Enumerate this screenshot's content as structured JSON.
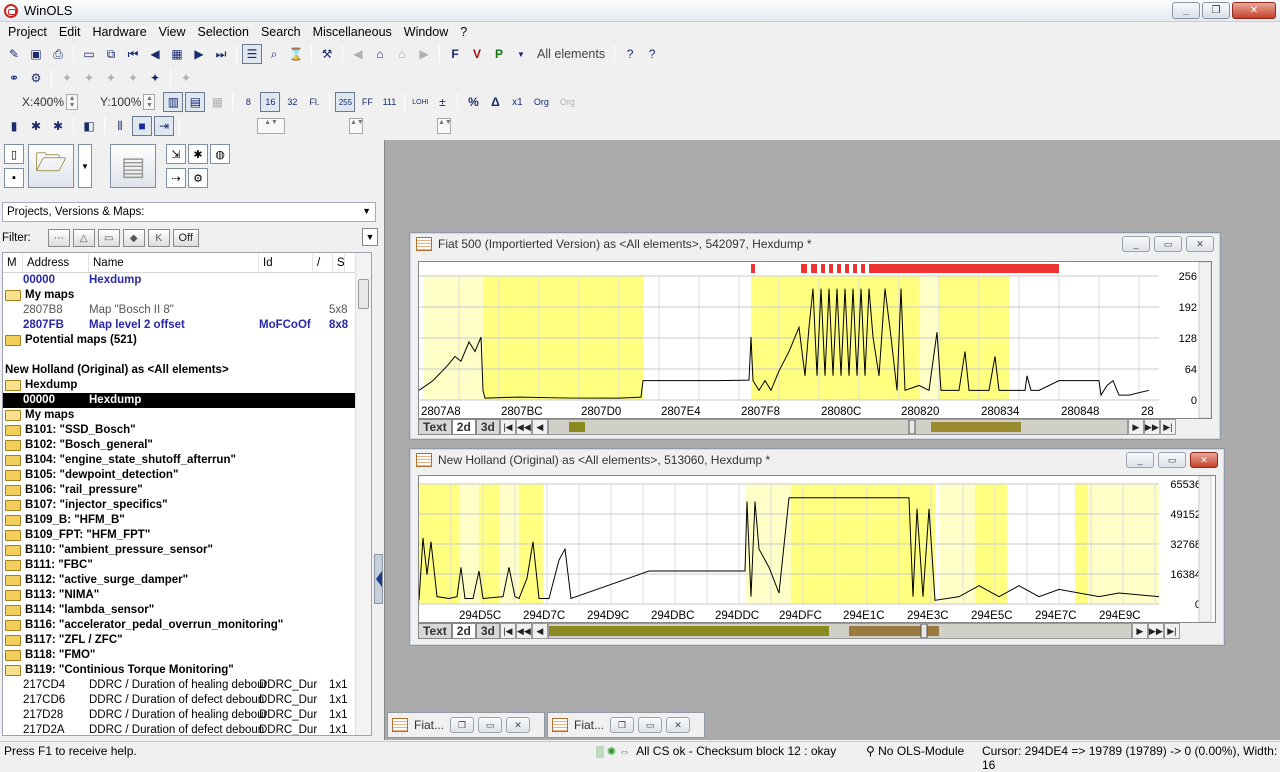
{
  "app": {
    "title": "WinOLS"
  },
  "menu": [
    "Project",
    "Edit",
    "Hardware",
    "View",
    "Selection",
    "Search",
    "Miscellaneous",
    "Window",
    "?"
  ],
  "toolbar1": {
    "elements_label": "All elements"
  },
  "toolbar2": {
    "zoom_x": "X:400%",
    "zoom_y": "Y:100%",
    "btn_8": "8",
    "btn_16": "16",
    "btn_32": "32",
    "btn_fl": "Fl.",
    "btn_255": "255",
    "btn_ff": "FF",
    "btn_111": "111",
    "btn_lohi": "LOHI",
    "btn_percent": "%",
    "btn_delta": "Δ",
    "btn_x1": "x1",
    "btn_org": "Org",
    "btn_org2": "Org"
  },
  "left": {
    "dropdown": "Projects, Versions & Maps:",
    "filter_label": "Filter:",
    "filter_off": "Off",
    "columns": {
      "m": "M",
      "address": "Address",
      "name": "Name",
      "id": "Id",
      "slash": "/",
      "s": "S"
    },
    "rows1": [
      {
        "addr": "00000",
        "name": "Hexdump",
        "style": "blue"
      }
    ],
    "group_mymaps": "My maps",
    "rows_mymaps": [
      {
        "addr": "2807B8",
        "name": "Map \"Bosch II 8\"",
        "id": "",
        "size": "5x8",
        "style": "gray"
      },
      {
        "addr": "2807FB",
        "name": "Map level 2 offset",
        "id": "MoFCoOf",
        "size": "8x8",
        "style": "blue"
      }
    ],
    "group_potential": "Potential maps (521)",
    "section_nh": "New Holland (Original) as <All elements>",
    "group_hexdump": "Hexdump",
    "row_selected": {
      "addr": "00000",
      "name": "Hexdump"
    },
    "group_mymaps2": "My maps",
    "groups": [
      "B101: \"SSD_Bosch\"",
      "B102: \"Bosch_general\"",
      "B104: \"engine_state_shutoff_afterrun\"",
      "B105: \"dewpoint_detection\"",
      "B106: \"rail_pressure\"",
      "B107: \"injector_specifics\"",
      "B109_B: \"HFM_B\"",
      "B109_FPT: \"HFM_FPT\"",
      "B110: \"ambient_pressure_sensor\"",
      "B111: \"FBC\"",
      "B112: \"active_surge_damper\"",
      "B113: \"NIMA\"",
      "B114: \"lambda_sensor\"",
      "B116: \"accelerator_pedal_overrun_monitoring\"",
      "B117: \"ZFL / ZFC\"",
      "B118: \"FMO\"",
      "B119: \"Continious Torque Monitoring\""
    ],
    "rows_b119": [
      {
        "addr": "217CD4",
        "name": "DDRC / Duration of healing debour",
        "id": "DDRC_Dur",
        "size": "1x1"
      },
      {
        "addr": "217CD6",
        "name": "DDRC / Duration of defect deboun",
        "id": "DDRC_Dur",
        "size": "1x1"
      },
      {
        "addr": "217D28",
        "name": "DDRC / Duration of healing debour",
        "id": "DDRC_Dur",
        "size": "1x1"
      },
      {
        "addr": "217D2A",
        "name": "DDRC / Duration of defect deboun",
        "id": "DDRC_Dur",
        "size": "1x1"
      }
    ]
  },
  "win1": {
    "title": "Fiat 500 (Importierted Version) as <All elements>, 542097, Hexdump *",
    "yticks": [
      "256",
      "192",
      "128",
      "64",
      "0"
    ],
    "xticks": [
      "2807A8",
      "2807BC",
      "2807D0",
      "2807E4",
      "2807F8",
      "28080C",
      "280820",
      "280834",
      "280848",
      "28"
    ],
    "tabs": [
      "Text",
      "2d",
      "3d"
    ]
  },
  "win2": {
    "title": "New Holland (Original) as <All elements>, 513060, Hexdump *",
    "yticks": [
      "65536",
      "49152",
      "32768",
      "16384",
      "0"
    ],
    "xticks": [
      "294D5C",
      "294D7C",
      "294D9C",
      "294DBC",
      "294DDC",
      "294DFC",
      "294E1C",
      "294E3C",
      "294E5C",
      "294E7C",
      "294E9C"
    ],
    "tabs": [
      "Text",
      "2d",
      "3d"
    ]
  },
  "minimized": [
    "Fiat...",
    "Fiat..."
  ],
  "status": {
    "help": "Press F1 to receive help.",
    "checksum": "All CS ok - Checksum block 12 : okay",
    "module": "No OLS-Module",
    "cursor": "Cursor: 294DE4 => 19789 (19789) -> 0 (0.00%), Width: 16"
  },
  "colors": {
    "highlight": "#ffff80",
    "highlight_pale": "#ffffc8",
    "marker": "#ee3333",
    "selection": "#000000"
  }
}
